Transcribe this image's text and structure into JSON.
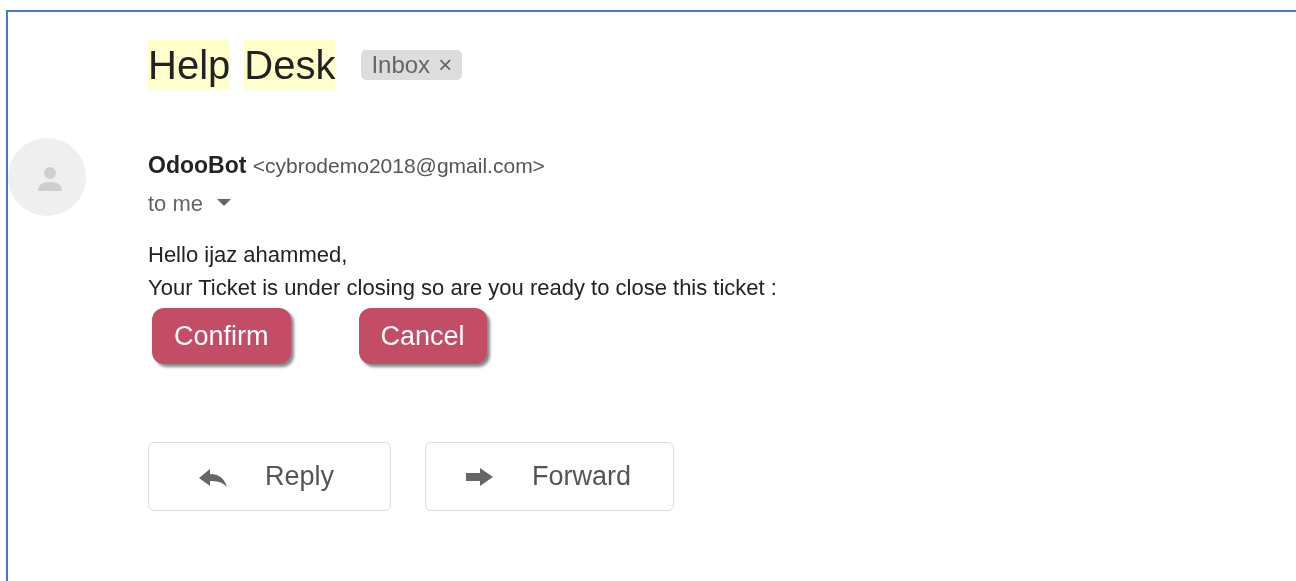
{
  "subject_words": [
    "Help",
    "Desk"
  ],
  "label": {
    "text": "Inbox",
    "close": "×"
  },
  "sender": {
    "name": "OdooBot",
    "email": "<cybrodemo2018@gmail.com>",
    "recipient": "to me"
  },
  "body": [
    "Hello ijaz ahammed,",
    "Your Ticket is under closing so are you ready to close this ticket :"
  ],
  "actions": [
    "Confirm",
    "Cancel"
  ],
  "footer_buttons": [
    {
      "kind": "reply",
      "label": "Reply"
    },
    {
      "kind": "forward",
      "label": "Forward"
    }
  ]
}
